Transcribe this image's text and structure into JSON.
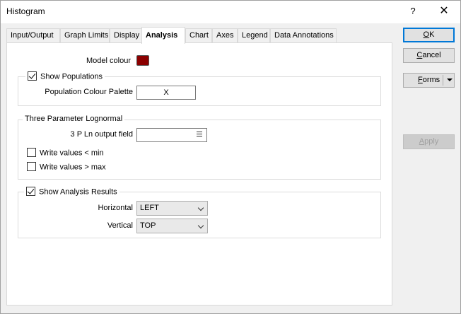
{
  "window": {
    "title": "Histogram",
    "help_label": "?",
    "close_label": "✕"
  },
  "tabs": [
    {
      "label": "Input/Output",
      "active": false
    },
    {
      "label": "Graph Limits",
      "active": false
    },
    {
      "label": "Display",
      "active": false
    },
    {
      "label": "Analysis",
      "active": true
    },
    {
      "label": "Chart",
      "active": false
    },
    {
      "label": "Axes",
      "active": false
    },
    {
      "label": "Legend",
      "active": false
    },
    {
      "label": "Data Annotations",
      "active": false
    }
  ],
  "analysis": {
    "model_colour_label": "Model colour",
    "model_colour": "#8b0000",
    "show_populations": {
      "label": "Show Populations",
      "checked": true
    },
    "population_palette_label": "Population Colour Palette",
    "population_palette_value": "X",
    "lognormal": {
      "legend": "Three Parameter Lognormal",
      "output_field_label": "3 P Ln output field",
      "output_field_value": "",
      "write_min": {
        "label": "Write values < min",
        "checked": false
      },
      "write_max": {
        "label": "Write values > max",
        "checked": false
      }
    },
    "show_results": {
      "label": "Show Analysis Results",
      "checked": true
    },
    "horizontal_label": "Horizontal",
    "horizontal_value": "LEFT",
    "vertical_label": "Vertical",
    "vertical_value": "TOP"
  },
  "buttons": {
    "ok": {
      "label": "OK",
      "accel": "O",
      "rest": "K"
    },
    "cancel": {
      "label": "Cancel",
      "accel": "C",
      "rest": "ancel"
    },
    "forms": {
      "label": "Forms",
      "accel": "F",
      "rest": "orms"
    },
    "apply": {
      "label": "Apply",
      "accel": "A",
      "rest": "pply"
    }
  },
  "colors": {
    "accent": "#0078d7",
    "model_colour": "#8b0000"
  }
}
